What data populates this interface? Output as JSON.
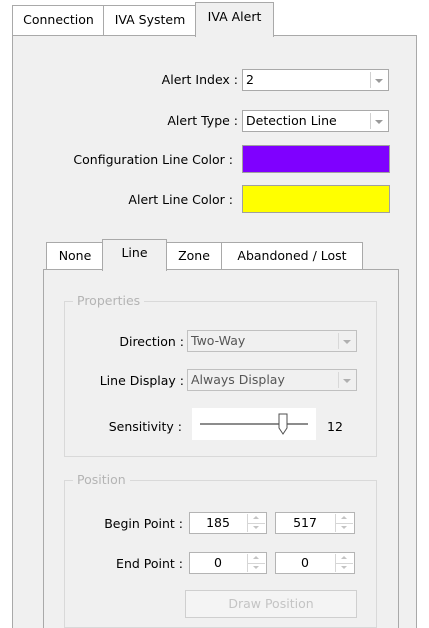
{
  "top_tabs": [
    {
      "label": "Connection"
    },
    {
      "label": "IVA System"
    },
    {
      "label": "IVA Alert"
    }
  ],
  "alert": {
    "index_label": "Alert Index :",
    "index_value": "2",
    "type_label": "Alert Type :",
    "type_value": "Detection Line",
    "config_color_label": "Configuration Line Color :",
    "config_color": "#7f00ff",
    "alert_color_label": "Alert Line Color :",
    "alert_color": "#ffff00"
  },
  "inner_tabs": [
    {
      "label": "None"
    },
    {
      "label": "Line"
    },
    {
      "label": "Zone"
    },
    {
      "label": "Abandoned / Lost"
    }
  ],
  "properties": {
    "title": "Properties",
    "direction_label": "Direction :",
    "direction_value": "Two-Way",
    "line_display_label": "Line Display :",
    "line_display_value": "Always Display",
    "sensitivity_label": "Sensitivity :",
    "sensitivity_value": "12"
  },
  "position": {
    "title": "Position",
    "begin_label": "Begin Point :",
    "begin_x": "185",
    "begin_y": "517",
    "end_label": "End Point :",
    "end_x": "0",
    "end_y": "0",
    "draw_button": "Draw Position"
  }
}
